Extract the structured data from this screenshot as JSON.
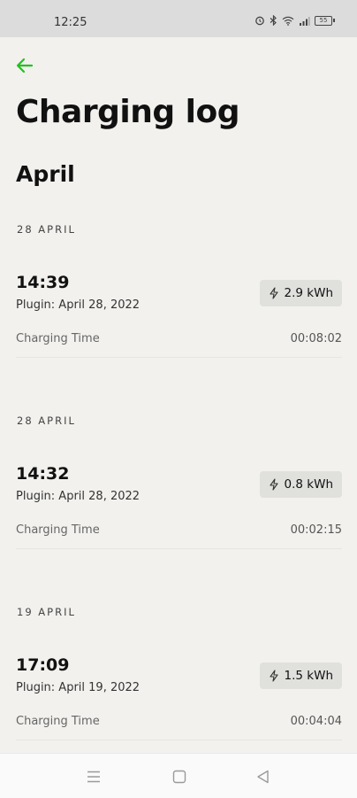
{
  "status_bar": {
    "time": "12:25",
    "battery": "55"
  },
  "header": {
    "title": "Charging log",
    "month": "April"
  },
  "entries": [
    {
      "date_header": "28 APRIL",
      "time": "14:39",
      "plugin": "Plugin: April 28, 2022",
      "energy": "2.9 kWh",
      "label": "Charging Time",
      "duration": "00:08:02"
    },
    {
      "date_header": "28 APRIL",
      "time": "14:32",
      "plugin": "Plugin: April 28, 2022",
      "energy": "0.8 kWh",
      "label": "Charging Time",
      "duration": "00:02:15"
    },
    {
      "date_header": "19 APRIL",
      "time": "17:09",
      "plugin": "Plugin: April 19, 2022",
      "energy": "1.5 kWh",
      "label": "Charging Time",
      "duration": "00:04:04"
    }
  ],
  "colors": {
    "accent": "#22c21f",
    "background": "#f2f1ee",
    "badge": "#e0e0dd"
  },
  "icons": {
    "back": "arrow-left-icon",
    "energy": "lightning-icon",
    "nav_menu": "menu-icon",
    "nav_home": "home-square-icon",
    "nav_back": "triangle-back-icon"
  }
}
